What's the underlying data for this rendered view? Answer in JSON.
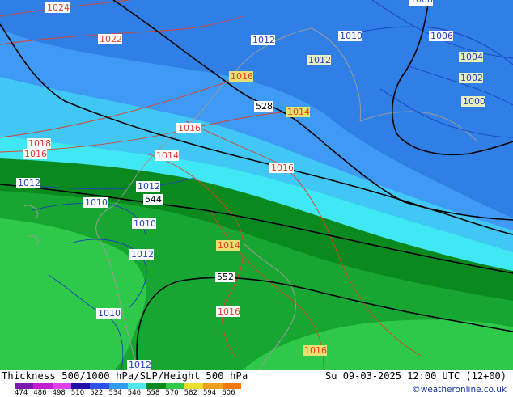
{
  "map": {
    "colors": {
      "thickness_band_blue_dark": "#2f7fe6",
      "thickness_band_blue": "#3f9af5",
      "thickness_band_light_blue": "#40c7f5",
      "thickness_band_cyan": "#3fe8f2",
      "thickness_band_green_dark": "#0a8a1e",
      "thickness_band_green": "#18a632",
      "thickness_band_green_light": "#2fc94a",
      "pressure_high_contour": "#e0402a",
      "pressure_low_contour": "#1f3fbf",
      "height_contour": "#000000",
      "coastline": "#9a9a9a"
    },
    "isobar_labels": [
      {
        "text": "1024",
        "kind": "high"
      },
      {
        "text": "1022",
        "kind": "high"
      },
      {
        "text": "1018",
        "kind": "high"
      },
      {
        "text": "1016",
        "kind": "high"
      },
      {
        "text": "1016",
        "kind": "high"
      },
      {
        "text": "1014",
        "kind": "high"
      },
      {
        "text": "1016",
        "kind": "high"
      },
      {
        "text": "1014",
        "kind": "high"
      },
      {
        "text": "1016",
        "kind": "high"
      },
      {
        "text": "1014",
        "kind": "high"
      },
      {
        "text": "1016",
        "kind": "high"
      },
      {
        "text": "1016",
        "kind": "high"
      },
      {
        "text": "1012",
        "kind": "low"
      },
      {
        "text": "1010",
        "kind": "low"
      },
      {
        "text": "1008",
        "kind": "low"
      },
      {
        "text": "1006",
        "kind": "low"
      },
      {
        "text": "1012",
        "kind": "low"
      },
      {
        "text": "1010",
        "kind": "low"
      },
      {
        "text": "1012",
        "kind": "low"
      },
      {
        "text": "1010",
        "kind": "low"
      },
      {
        "text": "1012",
        "kind": "low"
      },
      {
        "text": "1010",
        "kind": "low"
      },
      {
        "text": "1012",
        "kind": "low"
      },
      {
        "text": "1012",
        "kind": "neutral"
      },
      {
        "text": "1004",
        "kind": "neutral"
      },
      {
        "text": "1002",
        "kind": "neutral"
      },
      {
        "text": "1000",
        "kind": "neutral"
      }
    ],
    "height_labels": [
      "528",
      "544",
      "552"
    ]
  },
  "footer": {
    "title": "Thickness 500/1000 hPa/SLP/Height 500 hPa",
    "datetime": "Su 09-03-2025 12:00 UTC (12+00)",
    "credit": "©weatheronline.co.uk",
    "legend_values": [
      "474",
      "486",
      "498",
      "510",
      "522",
      "534",
      "546",
      "558",
      "570",
      "582",
      "594",
      "606"
    ],
    "legend_colors": [
      "#7a1bb0",
      "#c21ed0",
      "#e040e8",
      "#2010a8",
      "#2e52e6",
      "#2f9cf0",
      "#4de8f0",
      "#0a8a1e",
      "#2fc94a",
      "#e8e02a",
      "#f0a020",
      "#f07a10"
    ]
  }
}
